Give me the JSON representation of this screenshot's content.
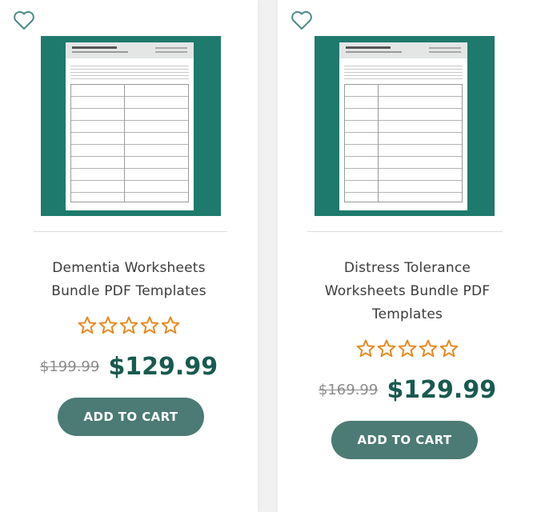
{
  "colors": {
    "accent_teal": "#1e7a6c",
    "button_bg": "#4b7b74",
    "price_color": "#185a4f",
    "star_color": "#e8891f",
    "heart_color": "#4a8a83"
  },
  "products": [
    {
      "title_line1": "Dementia Worksheets",
      "title_line2": "Bundle PDF Templates",
      "title_line3": "",
      "rating_stars_filled": 0,
      "rating_stars_total": 5,
      "old_price": "$199.99",
      "price": "$129.99",
      "button_label": "ADD TO CART",
      "wishlist_icon": "heart-outline-icon"
    },
    {
      "title_line1": "Distress Tolerance",
      "title_line2": "Worksheets Bundle PDF",
      "title_line3": "Templates",
      "rating_stars_filled": 0,
      "rating_stars_total": 5,
      "old_price": "$169.99",
      "price": "$129.99",
      "button_label": "ADD TO CART",
      "wishlist_icon": "heart-outline-icon"
    }
  ]
}
